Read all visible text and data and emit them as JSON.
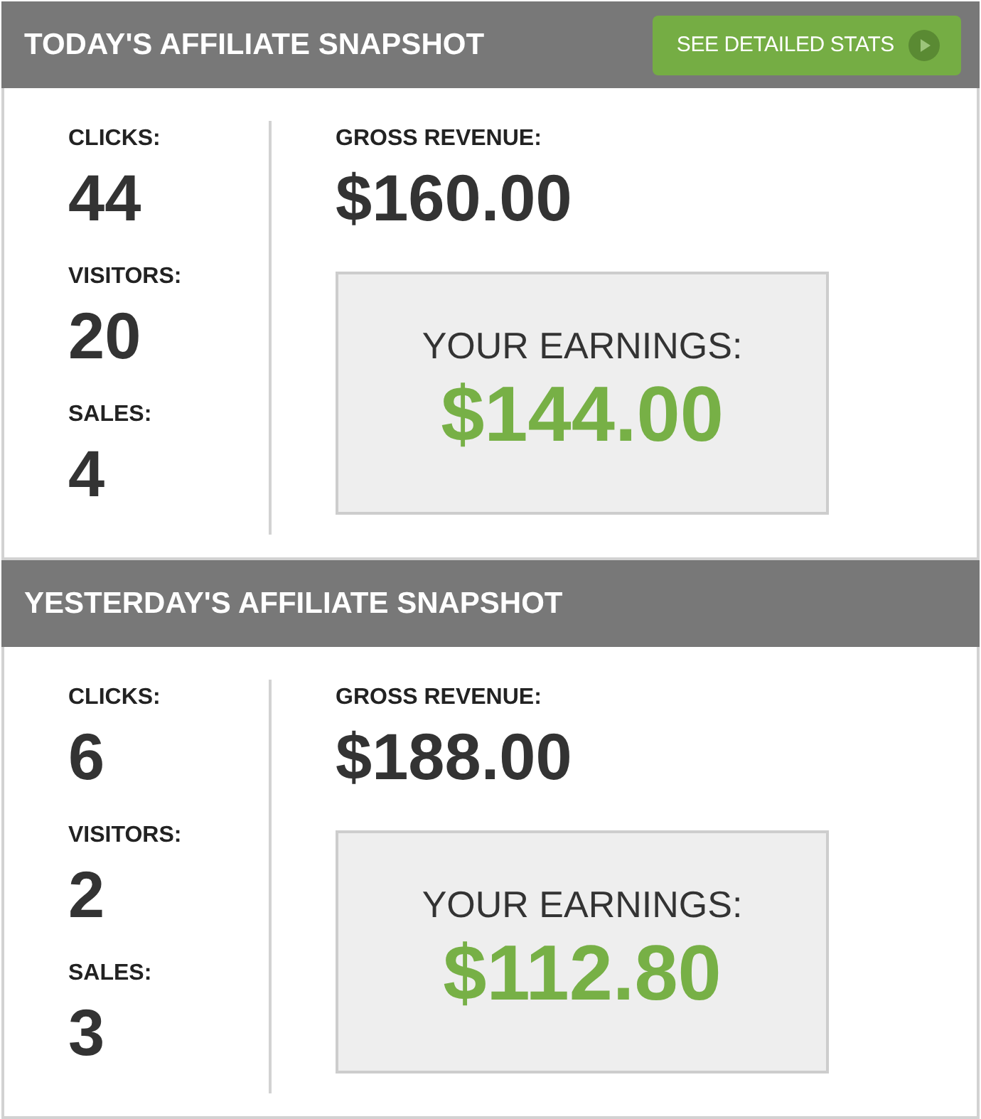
{
  "panels": [
    {
      "title": "TODAY'S AFFILIATE SNAPSHOT",
      "button": {
        "label": "SEE DETAILED STATS"
      },
      "stats": [
        {
          "label": "CLICKS:",
          "value": "44"
        },
        {
          "label": "VISITORS:",
          "value": "20"
        },
        {
          "label": "SALES:",
          "value": "4"
        }
      ],
      "gross_revenue": {
        "label": "GROSS REVENUE:",
        "value": "$160.00"
      },
      "earnings": {
        "label": "YOUR EARNINGS:",
        "value": "$144.00"
      }
    },
    {
      "title": "YESTERDAY'S AFFILIATE SNAPSHOT",
      "stats": [
        {
          "label": "CLICKS:",
          "value": "6"
        },
        {
          "label": "VISITORS:",
          "value": "2"
        },
        {
          "label": "SALES:",
          "value": "3"
        }
      ],
      "gross_revenue": {
        "label": "GROSS REVENUE:",
        "value": "$188.00"
      },
      "earnings": {
        "label": "YOUR EARNINGS:",
        "value": "$112.80"
      }
    }
  ]
}
